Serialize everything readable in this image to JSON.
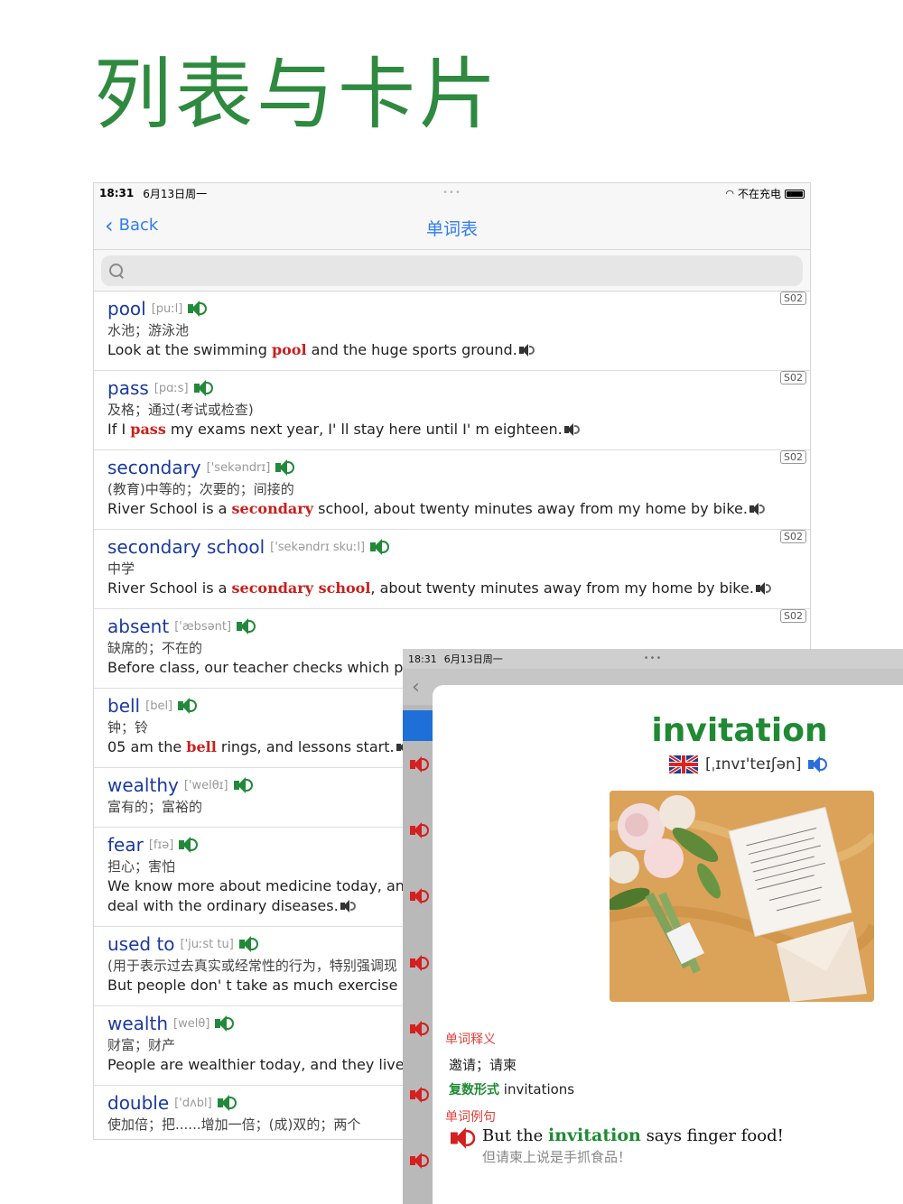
{
  "headline": "列表与卡片",
  "list_screen": {
    "status": {
      "time": "18:31",
      "date": "6月13日周一",
      "charging": "不在充电"
    },
    "nav": {
      "back_label": "Back",
      "title": "单词表"
    },
    "search": {
      "placeholder": ""
    },
    "entries": [
      {
        "tag": "S02",
        "word": "pool",
        "phonetic": "[puːl]",
        "cn": "水池；游泳池",
        "ex_pre": "Look at the swimming ",
        "ex_hl": "pool",
        "ex_post": " and the huge sports ground."
      },
      {
        "tag": "S02",
        "word": "pass",
        "phonetic": "[pɑːs]",
        "cn": "及格；通过(考试或检查)",
        "ex_pre": "If I ",
        "ex_hl": "pass",
        "ex_post": " my exams next year, I' ll stay here until I' m eighteen."
      },
      {
        "tag": "S02",
        "word": "secondary",
        "phonetic": "['sekəndrɪ]",
        "cn": "(教育)中等的；次要的；间接的",
        "ex_pre": "River School is a ",
        "ex_hl": "secondary",
        "ex_post": " school, about twenty minutes away from my home by bike."
      },
      {
        "tag": "S02",
        "word": "secondary school",
        "phonetic": "['sekəndrɪ skuːl]",
        "cn": "中学",
        "ex_pre": "River School is a ",
        "ex_hl": "secondary school",
        "ex_post": ", about twenty minutes away from my home by bike."
      },
      {
        "tag": "S02",
        "word": "absent",
        "phonetic": "['æbsənt]",
        "cn": "缺席的；不在的",
        "ex_pre": "Before class, our teacher checks which pu",
        "ex_hl": "",
        "ex_post": ""
      },
      {
        "tag": "",
        "word": "bell",
        "phonetic": "[bel]",
        "cn": "钟；铃",
        "ex_pre": "05 am the ",
        "ex_hl": "bell",
        "ex_post": " rings, and lessons start."
      },
      {
        "tag": "",
        "word": "wealthy",
        "phonetic": "['welθɪ]",
        "cn": "富有的；富裕的",
        "ex_pre": "",
        "ex_hl": "",
        "ex_post": ""
      },
      {
        "tag": "",
        "word": "fear",
        "phonetic": "[fɪə]",
        "cn": "担心；害怕",
        "ex_pre": "We know more about medicine today, and",
        "ex_hl": "",
        "ex_post": "",
        "ex2": "deal with the ordinary diseases."
      },
      {
        "tag": "",
        "word": "used to",
        "phonetic": "['juːst tu]",
        "cn": "(用于表示过去真实或经常性的行为，特别强调现",
        "ex_pre": "But people don' t take as much exercise as",
        "ex_hl": "",
        "ex_post": ""
      },
      {
        "tag": "",
        "word": "wealth",
        "phonetic": "[welθ]",
        "cn": "财富；财产",
        "ex_pre": "People are wealthier today, and they live lo",
        "ex_hl": "",
        "ex_post": ""
      },
      {
        "tag": "",
        "word": "double",
        "phonetic": "['dʌbl]",
        "cn": "使加倍；把......增加一倍；(成)双的；两个",
        "ex_pre": "",
        "ex_hl": "",
        "ex_post": ""
      }
    ]
  },
  "card_screen": {
    "status": {
      "time": "18:31",
      "date": "6月13日周一"
    },
    "word": "invitation",
    "phonetic": "[ˌɪnvɪ'teɪʃən]",
    "meaning_label": "单词释义",
    "meaning": "邀请；请柬",
    "plural_label": "复数形式",
    "plural": "invitations",
    "example_label": "单词例句",
    "example_pre": "But the ",
    "example_hl": "invitation",
    "example_post": " says finger food!",
    "example_cn": "但请柬上说是手抓食品！"
  },
  "colors": {
    "headline": "#2f8a3f",
    "word_blue": "#1a3aa0",
    "highlight_red": "#c8201c",
    "card_green": "#1f8a33",
    "ios_blue": "#2e7cf6"
  }
}
